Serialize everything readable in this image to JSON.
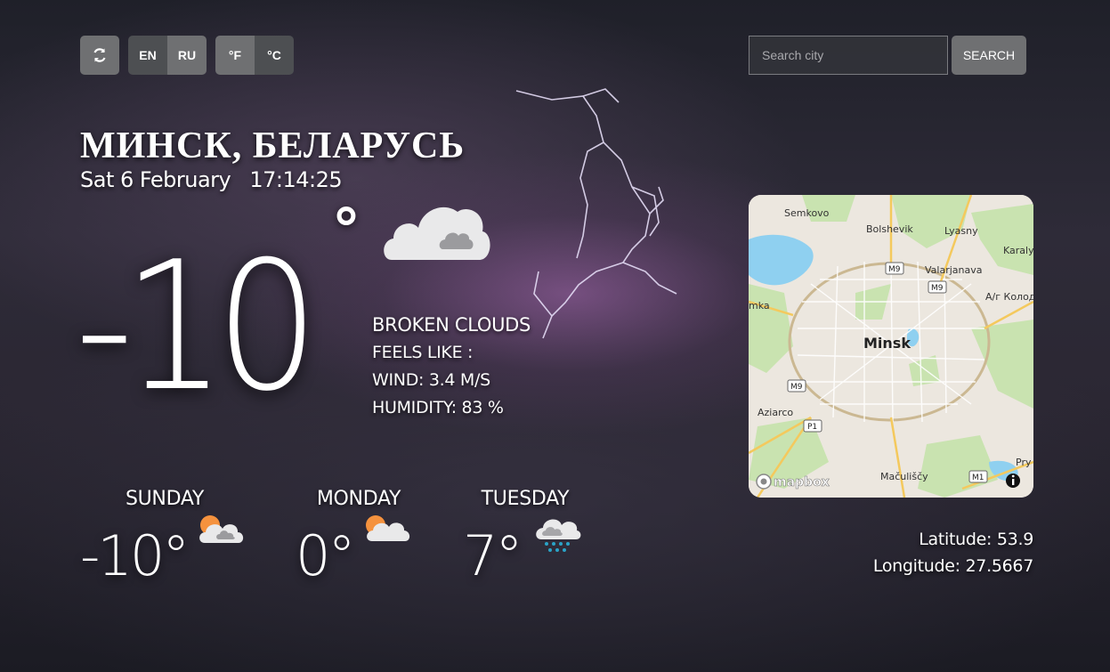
{
  "toolbar": {
    "refresh_icon": "refresh-icon",
    "lang_en": "EN",
    "lang_ru": "RU",
    "unit_f": "°F",
    "unit_c": "°C"
  },
  "search": {
    "placeholder": "Search city",
    "button_label": "SEARCH"
  },
  "location": {
    "city": "МИНСК, БЕЛАРУСЬ",
    "date": "Sat 6 February",
    "time": "17:14:25"
  },
  "current": {
    "temperature": "-10",
    "degree": "°",
    "icon": "broken-clouds-icon",
    "description": "BROKEN CLOUDS",
    "feels_like": "FEELS LIKE :",
    "wind": "WIND: 3.4 M/S",
    "humidity": "HUMIDITY: 83 %"
  },
  "forecast": [
    {
      "day": "SUNDAY",
      "temp": "-10°",
      "icon": "partly-cloudy-icon"
    },
    {
      "day": "MONDAY",
      "temp": "0°",
      "icon": "partly-cloudy-icon"
    },
    {
      "day": "TUESDAY",
      "temp": "7°",
      "icon": "snow-cloud-icon"
    }
  ],
  "map": {
    "labels": {
      "semkovo": "Semkovo",
      "bolshevik": "Bolshevik",
      "lyasny": "Lyasny",
      "karaly": "Karaly",
      "valarjanava": "Valarjanava",
      "akolod": "А/г Колод",
      "mka": "mka",
      "minsk": "Minsk",
      "aziarco": "Aziarco",
      "maculiscy": "Mačuliščy",
      "pry": "Pry",
      "m9a": "M9",
      "m9b": "M9",
      "m9c": "M9",
      "p1": "P1",
      "m1": "M1",
      "brand": "mapbox"
    }
  },
  "coordinates": {
    "latitude": "Latitude: 53.9",
    "longitude": "Longitude: 27.5667"
  },
  "colors": {
    "button": "#6f7072",
    "button_dark": "#4d4f52",
    "sun": "#f5923e",
    "snow": "#2aa3c7"
  }
}
